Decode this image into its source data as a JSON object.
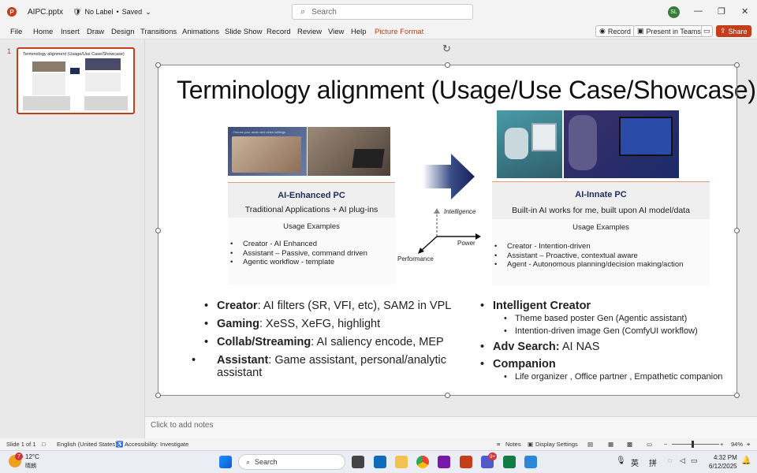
{
  "titlebar": {
    "file_name": "AIPC.pptx",
    "label": "No Label",
    "saved": "Saved",
    "search_placeholder": "Search",
    "avatar": "SL"
  },
  "ribbon": {
    "tabs": [
      "File",
      "Home",
      "Insert",
      "Draw",
      "Design",
      "Transitions",
      "Animations",
      "Slide Show",
      "Record",
      "Review",
      "View",
      "Help",
      "Picture Format"
    ],
    "record": "Record",
    "present": "Present in Teams",
    "share": "Share"
  },
  "thumbnail": {
    "number": "1",
    "title": "Terminology alignment (Usage/Use Case/Showcase)"
  },
  "slide": {
    "title": "Terminology alignment (Usage/Use Case/Showcase)",
    "left_panel": {
      "title": "AI-Enhanced PC",
      "subtitle": "Traditional Applications + AI plug-ins",
      "examples_header": "Usage Examples",
      "items": [
        "Creator - AI Enhanced",
        "Assistant – Passive, command driven",
        "Agentic workflow - template"
      ],
      "screen_text": "Choose your audio and video settings"
    },
    "axes": {
      "intelligence": "Intelligence",
      "power": "Power",
      "performance": "Performance"
    },
    "right_panel": {
      "title": "AI-Innate PC",
      "subtitle": "Built-in AI works for me, built upon AI model/data",
      "examples_header": "Usage Examples",
      "items": [
        "Creator - Intention-driven",
        "Assistant – Proactive, contextual aware",
        "Agent - Autonomous planning/decision making/action"
      ]
    },
    "left_bullets": [
      {
        "label": "Creator",
        "text": ": AI filters (SR, VFI, etc), SAM2 in VPL"
      },
      {
        "label": "Gaming",
        "text": ": XeSS, XeFG, highlight"
      },
      {
        "label": "Collab/Streaming",
        "text": ": AI saliency encode, MEP"
      },
      {
        "label": "Assistant",
        "text": ": Game assistant, personal/analytic assistant"
      }
    ],
    "right_bullets": {
      "intelligent_creator": "Intelligent Creator",
      "ic_sub": [
        "Theme based poster Gen (Agentic assistant)",
        "Intention-driven image Gen (ComfyUI workflow)"
      ],
      "adv_search_label": "Adv Search:",
      "adv_search_text": " AI NAS",
      "companion": "Companion",
      "companion_sub": [
        "Life organizer , Office partner , Empathetic companion"
      ]
    }
  },
  "notes_placeholder": "Click to add notes",
  "status": {
    "slide": "Slide 1 of 1",
    "language": "English (United States)",
    "accessibility": "Accessibility: Investigate",
    "notes": "Notes",
    "display": "Display Settings",
    "zoom": "94%"
  },
  "taskbar": {
    "temp": "12°C",
    "weather": "晴朗",
    "search": "Search",
    "ime1": "英",
    "ime2": "拼",
    "time": "4:32 PM",
    "date": "6/12/2025",
    "badge_weather": "7",
    "badge_teams": "9+"
  },
  "colors": {
    "accent": "#c43e1c",
    "navy": "#1f2d5c",
    "panel": "#efefef"
  }
}
